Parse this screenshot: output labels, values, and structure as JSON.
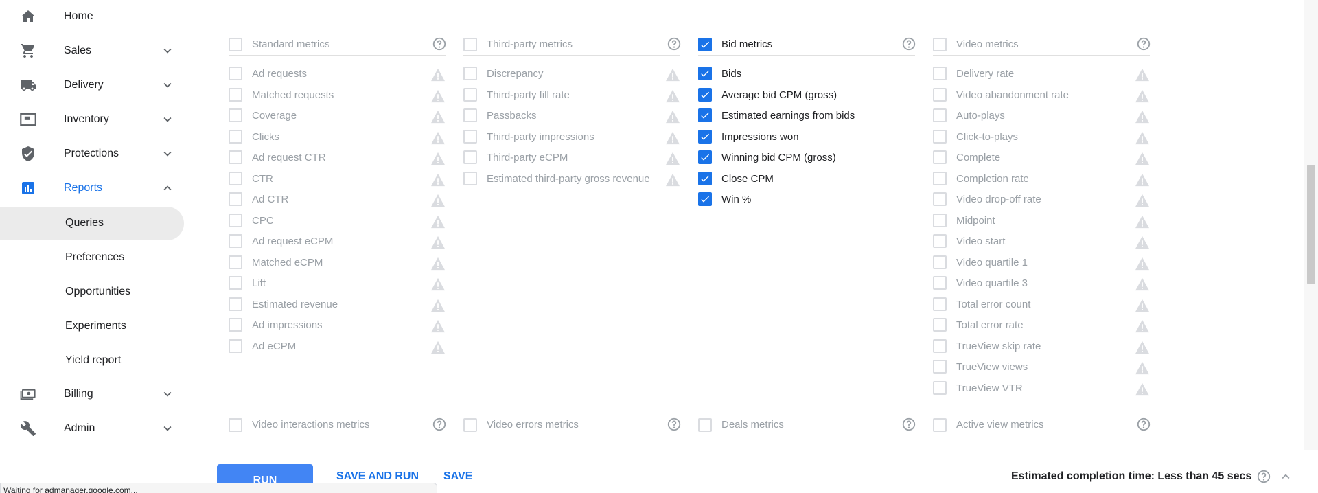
{
  "sidebar": {
    "items": [
      {
        "label": "Home",
        "icon": "home-icon",
        "expandable": false
      },
      {
        "label": "Sales",
        "icon": "cart-icon",
        "expandable": true
      },
      {
        "label": "Delivery",
        "icon": "truck-icon",
        "expandable": true
      },
      {
        "label": "Inventory",
        "icon": "inventory-icon",
        "expandable": true
      },
      {
        "label": "Protections",
        "icon": "shield-icon",
        "expandable": true
      },
      {
        "label": "Reports",
        "icon": "bar-chart-icon",
        "expandable": true,
        "expanded": true
      },
      {
        "label": "Billing",
        "icon": "money-icon",
        "expandable": true
      },
      {
        "label": "Admin",
        "icon": "wrench-icon",
        "expandable": true
      }
    ],
    "report_subitems": [
      {
        "label": "Queries",
        "selected": true
      },
      {
        "label": "Preferences"
      },
      {
        "label": "Opportunities"
      },
      {
        "label": "Experiments"
      },
      {
        "label": "Yield report"
      }
    ]
  },
  "metric_groups": [
    {
      "title": "Standard metrics",
      "checked": false,
      "items": [
        {
          "label": "Ad requests",
          "checked": false
        },
        {
          "label": "Matched requests",
          "checked": false
        },
        {
          "label": "Coverage",
          "checked": false
        },
        {
          "label": "Clicks",
          "checked": false
        },
        {
          "label": "Ad request CTR",
          "checked": false
        },
        {
          "label": "CTR",
          "checked": false
        },
        {
          "label": "Ad CTR",
          "checked": false
        },
        {
          "label": "CPC",
          "checked": false
        },
        {
          "label": "Ad request eCPM",
          "checked": false
        },
        {
          "label": "Matched eCPM",
          "checked": false
        },
        {
          "label": "Lift",
          "checked": false
        },
        {
          "label": "Estimated revenue",
          "checked": false
        },
        {
          "label": "Ad impressions",
          "checked": false
        },
        {
          "label": "Ad eCPM",
          "checked": false
        }
      ]
    },
    {
      "title": "Third-party metrics",
      "checked": false,
      "items": [
        {
          "label": "Discrepancy",
          "checked": false
        },
        {
          "label": "Third-party fill rate",
          "checked": false
        },
        {
          "label": "Passbacks",
          "checked": false
        },
        {
          "label": "Third-party impressions",
          "checked": false
        },
        {
          "label": "Third-party eCPM",
          "checked": false
        },
        {
          "label": "Estimated third-party gross revenue",
          "checked": false
        }
      ]
    },
    {
      "title": "Bid metrics",
      "checked": true,
      "items": [
        {
          "label": "Bids",
          "checked": true
        },
        {
          "label": "Average bid CPM (gross)",
          "checked": true
        },
        {
          "label": "Estimated earnings from bids",
          "checked": true
        },
        {
          "label": "Impressions won",
          "checked": true
        },
        {
          "label": "Winning bid CPM (gross)",
          "checked": true
        },
        {
          "label": "Close CPM",
          "checked": true
        },
        {
          "label": "Win %",
          "checked": true
        }
      ]
    },
    {
      "title": "Video metrics",
      "checked": false,
      "items": [
        {
          "label": "Delivery rate",
          "checked": false
        },
        {
          "label": "Video abandonment rate",
          "checked": false
        },
        {
          "label": "Auto-plays",
          "checked": false
        },
        {
          "label": "Click-to-plays",
          "checked": false
        },
        {
          "label": "Complete",
          "checked": false
        },
        {
          "label": "Completion rate",
          "checked": false
        },
        {
          "label": "Video drop-off rate",
          "checked": false
        },
        {
          "label": "Midpoint",
          "checked": false
        },
        {
          "label": "Video start",
          "checked": false
        },
        {
          "label": "Video quartile 1",
          "checked": false
        },
        {
          "label": "Video quartile 3",
          "checked": false
        },
        {
          "label": "Total error count",
          "checked": false
        },
        {
          "label": "Total error rate",
          "checked": false
        },
        {
          "label": "TrueView skip rate",
          "checked": false
        },
        {
          "label": "TrueView views",
          "checked": false
        },
        {
          "label": "TrueView VTR",
          "checked": false
        }
      ]
    }
  ],
  "lower_groups": [
    {
      "title": "Video interactions metrics"
    },
    {
      "title": "Video errors metrics"
    },
    {
      "title": "Deals metrics"
    },
    {
      "title": "Active view metrics"
    }
  ],
  "footer": {
    "run_label": "RUN",
    "save_and_run_label": "SAVE AND RUN",
    "save_label": "SAVE",
    "estimate_text": "Estimated completion time: Less than 45 secs"
  },
  "status_bar": {
    "text": "Waiting for admanager.google.com..."
  },
  "colors": {
    "accent": "#1a73e8",
    "run_button": "#4285f4",
    "disabled_text": "#9aa0a6",
    "selected_bg": "#ebebeb"
  }
}
